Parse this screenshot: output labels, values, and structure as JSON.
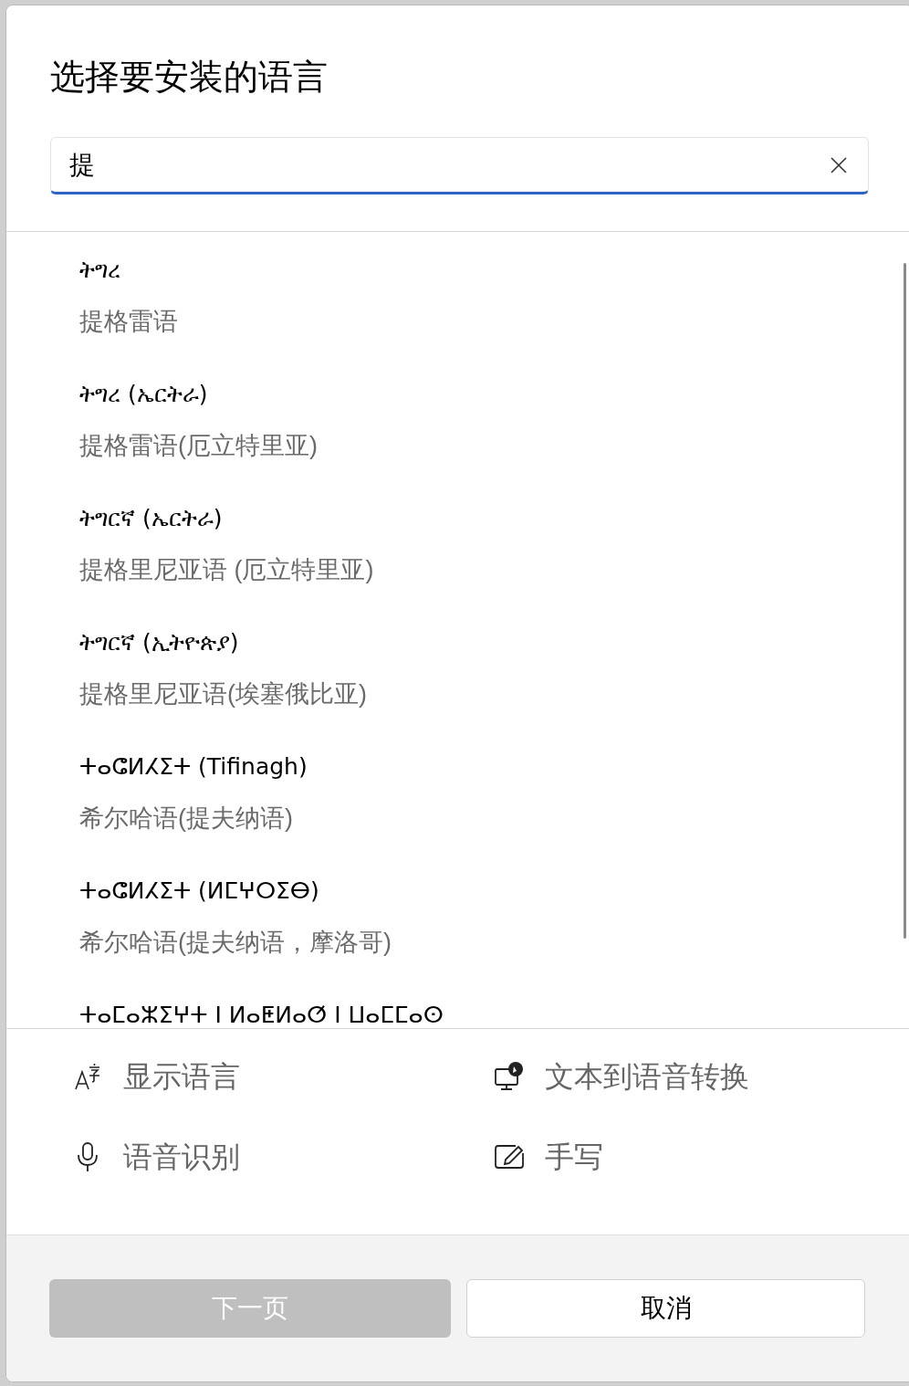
{
  "title": "选择要安装的语言",
  "search": {
    "value": "提"
  },
  "languages": [
    {
      "native": "ትግረ",
      "name": "提格雷语"
    },
    {
      "native": "ትግረ (ኤርትራ)",
      "name": "提格雷语(厄立特里亚)"
    },
    {
      "native": "ትግርኛ (ኤርትራ)",
      "name": "提格里尼亚语 (厄立特里亚)"
    },
    {
      "native": "ትግርኛ (ኢትዮጵያ)",
      "name": "提格里尼亚语(埃塞俄比亚)"
    },
    {
      "native": "ⵜⴰⵛⵍⵃⵉⵜ (Tifinagh)",
      "name": "希尔哈语(提夫纳语)"
    },
    {
      "native": "ⵜⴰⵛⵍⵃⵉⵜ (ⵍⵎⵖⵔⵉⴱ)",
      "name": "希尔哈语(提夫纳语，摩洛哥)"
    },
    {
      "native": "ⵜⴰⵎⴰⵣⵉⵖⵜ ⵏ ⵍⴰⵟⵍⴰⵚ ⵏ ⵡⴰⵎⵎⴰⵙ"
    }
  ],
  "features": [
    {
      "kind": "display",
      "label": "显示语言"
    },
    {
      "kind": "tts",
      "label": "文本到语音转换"
    },
    {
      "kind": "speech",
      "label": "语音识别"
    },
    {
      "kind": "handwriting",
      "label": "手写"
    }
  ],
  "buttons": [
    {
      "label": "下一页",
      "disabled": true
    },
    {
      "label": "取消",
      "disabled": false
    }
  ]
}
